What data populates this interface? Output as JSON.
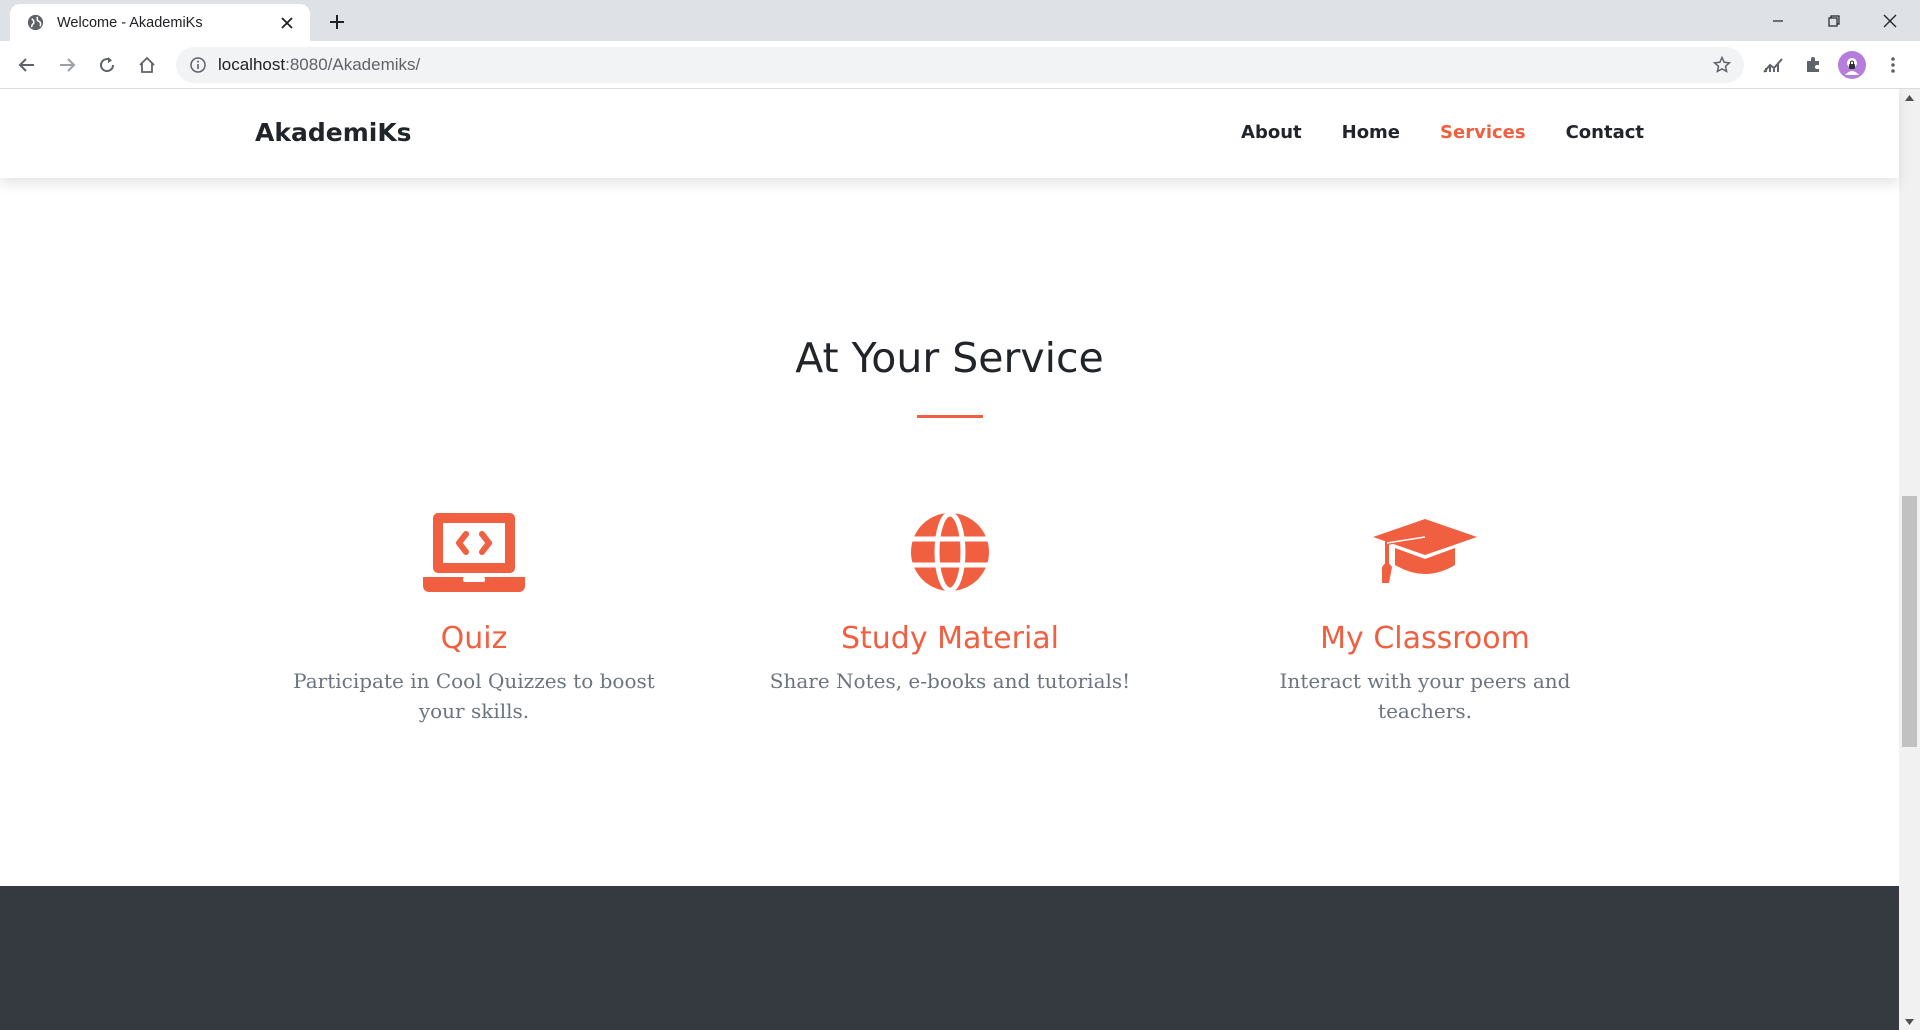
{
  "browser": {
    "tab_title": "Welcome - AkademiKs",
    "url_host": "localhost",
    "url_path": ":8080/Akademiks/"
  },
  "site": {
    "brand": "AkademiKs",
    "nav": [
      {
        "label": "About",
        "active": false
      },
      {
        "label": "Home",
        "active": false
      },
      {
        "label": "Services",
        "active": true
      },
      {
        "label": "Contact",
        "active": false
      }
    ]
  },
  "services": {
    "title": "At Your Service",
    "items": [
      {
        "icon": "laptop-code-icon",
        "heading": "Quiz",
        "text": "Participate in Cool Quizzes to boost your skills."
      },
      {
        "icon": "globe-icon",
        "heading": "Study Material",
        "text": "Share Notes, e-books and tutorials!"
      },
      {
        "icon": "graduation-cap-icon",
        "heading": "My Classroom",
        "text": "Interact with your peers and teachers."
      }
    ]
  },
  "colors": {
    "accent": "#f05f40",
    "heading": "#212529",
    "muted": "#6c757d",
    "dark_section": "#343a40"
  }
}
